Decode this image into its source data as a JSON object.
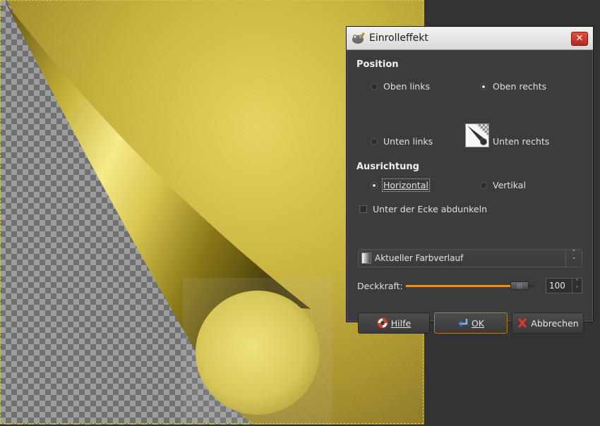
{
  "dialog": {
    "title": "Einrolleffekt",
    "close_label": "✕",
    "position": {
      "heading": "Position",
      "options": [
        "Oben links",
        "Oben rechts",
        "Unten links",
        "Unten rechts"
      ],
      "selected": "Oben rechts"
    },
    "orientation": {
      "heading": "Ausrichtung",
      "options": [
        "Horizontal",
        "Vertikal"
      ],
      "selected": "Horizontal"
    },
    "shade_checkbox": {
      "label": "Unter der Ecke abdunkeln",
      "checked": false
    },
    "gradient": {
      "selected": "Aktueller Farbverlauf"
    },
    "opacity": {
      "label": "Deckkraft:",
      "value": "100",
      "fraction": 0.95
    },
    "buttons": {
      "help": "Hilfe",
      "ok": "OK",
      "cancel": "Abbrechen"
    }
  },
  "colors": {
    "accent": "#e8902a",
    "dialog_bg": "#3c3c3c",
    "window_bg": "#333333",
    "gold": "#d4c040"
  },
  "icons": {
    "title": "gimp-wilber-icon",
    "help": "lifebuoy-icon",
    "ok": "enter-arrow-icon",
    "cancel": "red-x-icon",
    "preview": "page-curl-preview-icon"
  }
}
